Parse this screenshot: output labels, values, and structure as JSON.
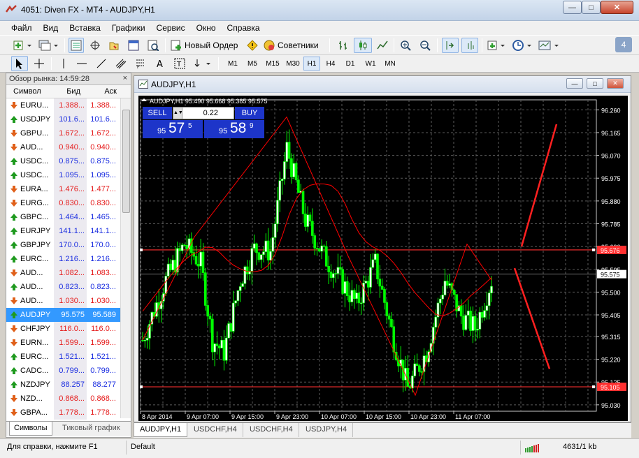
{
  "window": {
    "title": "4051: Diven FX - MT4 - AUDJPY,H1",
    "minimize": "—",
    "maximize": "□",
    "close": "✕"
  },
  "menu": [
    "Файл",
    "Вид",
    "Вставка",
    "Графики",
    "Сервис",
    "Окно",
    "Справка"
  ],
  "toolbar": {
    "new_order": "Новый Ордер",
    "experts": "Советники",
    "badge": "4",
    "timeframes": [
      "M1",
      "M5",
      "M15",
      "M30",
      "H1",
      "H4",
      "D1",
      "W1",
      "MN"
    ],
    "active_timeframe": "H1"
  },
  "market_watch": {
    "title": "Обзор рынка: 14:59:28",
    "close": "×",
    "col_symbol": "Символ",
    "col_bid": "Бид",
    "col_ask": "Аск",
    "rows": [
      {
        "symbol": "EURU...",
        "bid": "1.388...",
        "ask": "1.388...",
        "dir": "down"
      },
      {
        "symbol": "USDJPY",
        "bid": "101.6...",
        "ask": "101.6...",
        "dir": "up"
      },
      {
        "symbol": "GBPU...",
        "bid": "1.672...",
        "ask": "1.672...",
        "dir": "down"
      },
      {
        "symbol": "AUD...",
        "bid": "0.940...",
        "ask": "0.940...",
        "dir": "down"
      },
      {
        "symbol": "USDC...",
        "bid": "0.875...",
        "ask": "0.875...",
        "dir": "up"
      },
      {
        "symbol": "USDC...",
        "bid": "1.095...",
        "ask": "1.095...",
        "dir": "up"
      },
      {
        "symbol": "EURA...",
        "bid": "1.476...",
        "ask": "1.477...",
        "dir": "down"
      },
      {
        "symbol": "EURG...",
        "bid": "0.830...",
        "ask": "0.830...",
        "dir": "down"
      },
      {
        "symbol": "GBPC...",
        "bid": "1.464...",
        "ask": "1.465...",
        "dir": "up"
      },
      {
        "symbol": "EURJPY",
        "bid": "141.1...",
        "ask": "141.1...",
        "dir": "up"
      },
      {
        "symbol": "GBPJPY",
        "bid": "170.0...",
        "ask": "170.0...",
        "dir": "up"
      },
      {
        "symbol": "EURC...",
        "bid": "1.216...",
        "ask": "1.216...",
        "dir": "up"
      },
      {
        "symbol": "AUD...",
        "bid": "1.082...",
        "ask": "1.083...",
        "dir": "down"
      },
      {
        "symbol": "AUD...",
        "bid": "0.823...",
        "ask": "0.823...",
        "dir": "up"
      },
      {
        "symbol": "AUD...",
        "bid": "1.030...",
        "ask": "1.030...",
        "dir": "down"
      },
      {
        "symbol": "AUDJPY",
        "bid": "95.575",
        "ask": "95.589",
        "dir": "up",
        "selected": true
      },
      {
        "symbol": "CHFJPY",
        "bid": "116.0...",
        "ask": "116.0...",
        "dir": "down"
      },
      {
        "symbol": "EURN...",
        "bid": "1.599...",
        "ask": "1.599...",
        "dir": "down"
      },
      {
        "symbol": "EURC...",
        "bid": "1.521...",
        "ask": "1.521...",
        "dir": "up"
      },
      {
        "symbol": "CADC...",
        "bid": "0.799...",
        "ask": "0.799...",
        "dir": "up"
      },
      {
        "symbol": "NZDJPY",
        "bid": "88.257",
        "ask": "88.277",
        "dir": "up"
      },
      {
        "symbol": "NZD...",
        "bid": "0.868...",
        "ask": "0.868...",
        "dir": "down"
      },
      {
        "symbol": "GBPA...",
        "bid": "1.778...",
        "ask": "1.778...",
        "dir": "down"
      }
    ],
    "tabs": [
      "Символы",
      "Тиковый график"
    ]
  },
  "chart_window": {
    "title": "AUDJPY,H1",
    "info": "AUDJPY,H1  95.490 95.668 95.385 95.575",
    "one_click": {
      "sell": "SELL",
      "buy": "BUY",
      "lot": "0.22",
      "sell_pre": "95",
      "sell_big": "57",
      "sell_sup": "5",
      "buy_pre": "95",
      "buy_big": "58",
      "buy_sup": "9"
    }
  },
  "chart_data": {
    "type": "candlestick",
    "symbol": "AUDJPY",
    "timeframe": "H1",
    "ohlc_last": {
      "open": 95.49,
      "high": 95.668,
      "low": 95.385,
      "close": 95.575
    },
    "ylim": [
      95.015,
      96.29
    ],
    "yticks": [
      "96.260",
      "96.165",
      "96.070",
      "95.975",
      "95.880",
      "95.785",
      "95.690",
      "95.595",
      "95.500",
      "95.405",
      "95.315",
      "95.220",
      "95.125",
      "95.030"
    ],
    "xticks": [
      "8 Apr 2014",
      "9 Apr 07:00",
      "9 Apr 15:00",
      "9 Apr 23:00",
      "10 Apr 07:00",
      "10 Apr 15:00",
      "10 Apr 23:00",
      "11 Apr 07:00"
    ],
    "bid_price": "95.575",
    "hlines": [
      {
        "value": 95.676,
        "label": "95.676",
        "color": "#ff3030"
      },
      {
        "value": 95.105,
        "label": "95.105",
        "color": "#ff3030"
      }
    ],
    "grid": true,
    "colors": {
      "bull": "#ffffff",
      "bear": "#00ff00",
      "zigzag": "#ff0000",
      "ma": "#ff0000",
      "annotation": "#ff2020"
    }
  },
  "chart_tabs": [
    "AUDJPY,H1",
    "USDCHF,H4",
    "USDCHF,H4",
    "USDJPY,H4"
  ],
  "status": {
    "help": "Для справки, нажмите F1",
    "profile": "Default",
    "traffic": "4631/1 kb"
  }
}
